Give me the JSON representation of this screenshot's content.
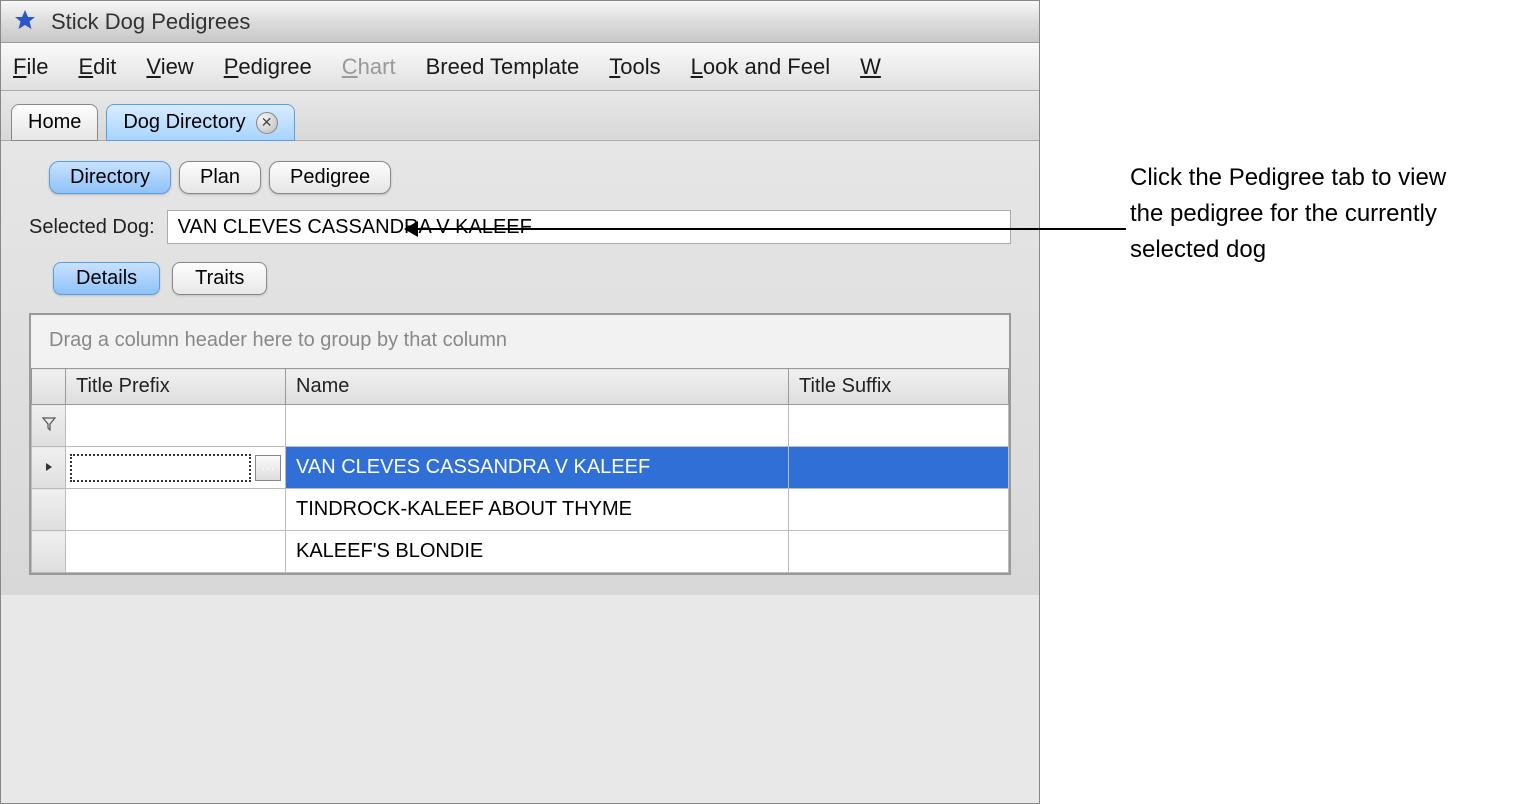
{
  "window": {
    "title": "Stick Dog Pedigrees"
  },
  "menu": {
    "file": "File",
    "edit": "Edit",
    "view": "View",
    "pedigree": "Pedigree",
    "chart": "Chart",
    "breed_template": "Breed Template",
    "tools": "Tools",
    "look_and_feel": "Look and Feel",
    "last": "W"
  },
  "tabs": {
    "home": "Home",
    "dog_directory": "Dog Directory"
  },
  "sub_tabs": {
    "directory": "Directory",
    "plan": "Plan",
    "pedigree": "Pedigree"
  },
  "selected": {
    "label": "Selected Dog:",
    "value": "VAN CLEVES CASSANDRA V KALEEF"
  },
  "detail_tabs": {
    "details": "Details",
    "traits": "Traits"
  },
  "grid": {
    "group_hint": "Drag a column header here to group by that column",
    "columns": {
      "prefix": "Title Prefix",
      "name": "Name",
      "suffix": "Title Suffix"
    },
    "ellipsis": "···",
    "rows": [
      {
        "prefix": "",
        "name": "VAN CLEVES CASSANDRA V KALEEF",
        "suffix": "",
        "selected": true
      },
      {
        "prefix": "",
        "name": "TINDROCK-KALEEF ABOUT THYME",
        "suffix": ""
      },
      {
        "prefix": "",
        "name": "KALEEF'S BLONDIE",
        "suffix": ""
      }
    ]
  },
  "annotation": {
    "text": "Click the Pedigree tab to view the pedigree for the currently selected dog"
  }
}
